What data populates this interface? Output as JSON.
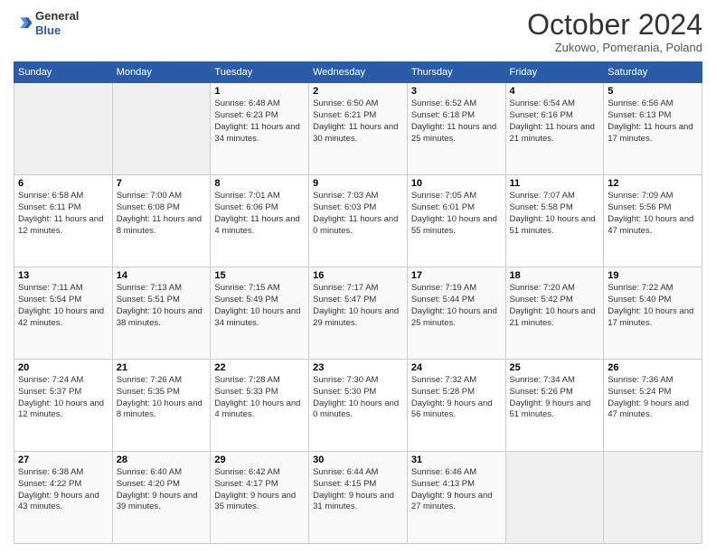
{
  "header": {
    "logo_line1": "General",
    "logo_line2": "Blue",
    "month": "October 2024",
    "location": "Zukowo, Pomerania, Poland"
  },
  "weekdays": [
    "Sunday",
    "Monday",
    "Tuesday",
    "Wednesday",
    "Thursday",
    "Friday",
    "Saturday"
  ],
  "weeks": [
    [
      {
        "day": "",
        "empty": true
      },
      {
        "day": "",
        "empty": true
      },
      {
        "day": "1",
        "sunrise": "Sunrise: 6:48 AM",
        "sunset": "Sunset: 6:23 PM",
        "daylight": "Daylight: 11 hours and 34 minutes."
      },
      {
        "day": "2",
        "sunrise": "Sunrise: 6:50 AM",
        "sunset": "Sunset: 6:21 PM",
        "daylight": "Daylight: 11 hours and 30 minutes."
      },
      {
        "day": "3",
        "sunrise": "Sunrise: 6:52 AM",
        "sunset": "Sunset: 6:18 PM",
        "daylight": "Daylight: 11 hours and 25 minutes."
      },
      {
        "day": "4",
        "sunrise": "Sunrise: 6:54 AM",
        "sunset": "Sunset: 6:16 PM",
        "daylight": "Daylight: 11 hours and 21 minutes."
      },
      {
        "day": "5",
        "sunrise": "Sunrise: 6:56 AM",
        "sunset": "Sunset: 6:13 PM",
        "daylight": "Daylight: 11 hours and 17 minutes."
      }
    ],
    [
      {
        "day": "6",
        "sunrise": "Sunrise: 6:58 AM",
        "sunset": "Sunset: 6:11 PM",
        "daylight": "Daylight: 11 hours and 12 minutes."
      },
      {
        "day": "7",
        "sunrise": "Sunrise: 7:00 AM",
        "sunset": "Sunset: 6:08 PM",
        "daylight": "Daylight: 11 hours and 8 minutes."
      },
      {
        "day": "8",
        "sunrise": "Sunrise: 7:01 AM",
        "sunset": "Sunset: 6:06 PM",
        "daylight": "Daylight: 11 hours and 4 minutes."
      },
      {
        "day": "9",
        "sunrise": "Sunrise: 7:03 AM",
        "sunset": "Sunset: 6:03 PM",
        "daylight": "Daylight: 11 hours and 0 minutes."
      },
      {
        "day": "10",
        "sunrise": "Sunrise: 7:05 AM",
        "sunset": "Sunset: 6:01 PM",
        "daylight": "Daylight: 10 hours and 55 minutes."
      },
      {
        "day": "11",
        "sunrise": "Sunrise: 7:07 AM",
        "sunset": "Sunset: 5:58 PM",
        "daylight": "Daylight: 10 hours and 51 minutes."
      },
      {
        "day": "12",
        "sunrise": "Sunrise: 7:09 AM",
        "sunset": "Sunset: 5:56 PM",
        "daylight": "Daylight: 10 hours and 47 minutes."
      }
    ],
    [
      {
        "day": "13",
        "sunrise": "Sunrise: 7:11 AM",
        "sunset": "Sunset: 5:54 PM",
        "daylight": "Daylight: 10 hours and 42 minutes."
      },
      {
        "day": "14",
        "sunrise": "Sunrise: 7:13 AM",
        "sunset": "Sunset: 5:51 PM",
        "daylight": "Daylight: 10 hours and 38 minutes."
      },
      {
        "day": "15",
        "sunrise": "Sunrise: 7:15 AM",
        "sunset": "Sunset: 5:49 PM",
        "daylight": "Daylight: 10 hours and 34 minutes."
      },
      {
        "day": "16",
        "sunrise": "Sunrise: 7:17 AM",
        "sunset": "Sunset: 5:47 PM",
        "daylight": "Daylight: 10 hours and 29 minutes."
      },
      {
        "day": "17",
        "sunrise": "Sunrise: 7:19 AM",
        "sunset": "Sunset: 5:44 PM",
        "daylight": "Daylight: 10 hours and 25 minutes."
      },
      {
        "day": "18",
        "sunrise": "Sunrise: 7:20 AM",
        "sunset": "Sunset: 5:42 PM",
        "daylight": "Daylight: 10 hours and 21 minutes."
      },
      {
        "day": "19",
        "sunrise": "Sunrise: 7:22 AM",
        "sunset": "Sunset: 5:40 PM",
        "daylight": "Daylight: 10 hours and 17 minutes."
      }
    ],
    [
      {
        "day": "20",
        "sunrise": "Sunrise: 7:24 AM",
        "sunset": "Sunset: 5:37 PM",
        "daylight": "Daylight: 10 hours and 12 minutes."
      },
      {
        "day": "21",
        "sunrise": "Sunrise: 7:26 AM",
        "sunset": "Sunset: 5:35 PM",
        "daylight": "Daylight: 10 hours and 8 minutes."
      },
      {
        "day": "22",
        "sunrise": "Sunrise: 7:28 AM",
        "sunset": "Sunset: 5:33 PM",
        "daylight": "Daylight: 10 hours and 4 minutes."
      },
      {
        "day": "23",
        "sunrise": "Sunrise: 7:30 AM",
        "sunset": "Sunset: 5:30 PM",
        "daylight": "Daylight: 10 hours and 0 minutes."
      },
      {
        "day": "24",
        "sunrise": "Sunrise: 7:32 AM",
        "sunset": "Sunset: 5:28 PM",
        "daylight": "Daylight: 9 hours and 56 minutes."
      },
      {
        "day": "25",
        "sunrise": "Sunrise: 7:34 AM",
        "sunset": "Sunset: 5:26 PM",
        "daylight": "Daylight: 9 hours and 51 minutes."
      },
      {
        "day": "26",
        "sunrise": "Sunrise: 7:36 AM",
        "sunset": "Sunset: 5:24 PM",
        "daylight": "Daylight: 9 hours and 47 minutes."
      }
    ],
    [
      {
        "day": "27",
        "sunrise": "Sunrise: 6:38 AM",
        "sunset": "Sunset: 4:22 PM",
        "daylight": "Daylight: 9 hours and 43 minutes."
      },
      {
        "day": "28",
        "sunrise": "Sunrise: 6:40 AM",
        "sunset": "Sunset: 4:20 PM",
        "daylight": "Daylight: 9 hours and 39 minutes."
      },
      {
        "day": "29",
        "sunrise": "Sunrise: 6:42 AM",
        "sunset": "Sunset: 4:17 PM",
        "daylight": "Daylight: 9 hours and 35 minutes."
      },
      {
        "day": "30",
        "sunrise": "Sunrise: 6:44 AM",
        "sunset": "Sunset: 4:15 PM",
        "daylight": "Daylight: 9 hours and 31 minutes."
      },
      {
        "day": "31",
        "sunrise": "Sunrise: 6:46 AM",
        "sunset": "Sunset: 4:13 PM",
        "daylight": "Daylight: 9 hours and 27 minutes."
      },
      {
        "day": "",
        "empty": true
      },
      {
        "day": "",
        "empty": true
      }
    ]
  ]
}
